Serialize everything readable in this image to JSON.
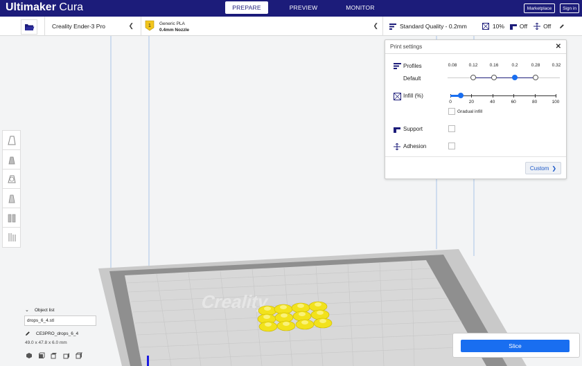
{
  "app": {
    "brand_bold": "Ultimaker",
    "brand_thin": " Cura"
  },
  "stages": {
    "prepare": "PREPARE",
    "preview": "PREVIEW",
    "monitor": "MONITOR"
  },
  "header_buttons": {
    "marketplace": "Marketplace",
    "signin": "Sign in"
  },
  "printer": {
    "name": "Creality Ender-3 Pro"
  },
  "material": {
    "name": "Generic PLA",
    "nozzle": "0.4mm Nozzle",
    "badge": "1"
  },
  "quality": {
    "profile": "Standard Quality - 0.2mm",
    "infill": "10%",
    "support": "Off",
    "adhesion": "Off"
  },
  "settings": {
    "title": "Print settings",
    "profiles_label": "Profiles",
    "profile_name": "Default",
    "profile_ticks": [
      "0.08",
      "0.12",
      "0.16",
      "0.2",
      "0.28",
      "0.32"
    ],
    "profile_selected_index": 3,
    "infill_label": "Infill (%)",
    "infill_ticks": [
      "0",
      "20",
      "40",
      "60",
      "80",
      "100"
    ],
    "infill_value": 10,
    "gradual_label": "Gradual infill",
    "support_label": "Support",
    "adhesion_label": "Adhesion",
    "custom_label": "Custom"
  },
  "object_list": {
    "header": "Object list",
    "field_value": "drops_6_4.stl",
    "object_name": "CE3PRO_drops_6_4",
    "dimensions": "49.0 x 47.8 x 6.0 mm"
  },
  "slice": {
    "label": "Slice"
  },
  "colors": {
    "brand": "#1c1c7a",
    "accent": "#196ef0",
    "model": "#f2e21c"
  }
}
